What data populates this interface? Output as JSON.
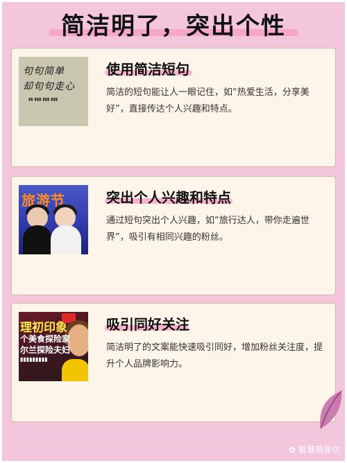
{
  "header": {
    "title": "简洁明了，突出个性"
  },
  "cards": [
    {
      "title": "使用简洁短句",
      "description": "简洁的短句能让人一眼记住，如“热爱生活，分享美好”，直接传达个人兴趣和特点。",
      "thumb": {
        "line1": "句句简单",
        "line2": "却句句走心"
      }
    },
    {
      "title": "突出个人兴趣和特点",
      "description": "通过短句突出个人兴趣，如“旅行达人，带你走遍世界”，吸引有相同兴趣的粉丝。",
      "thumb": {
        "tag": "旅游节"
      }
    },
    {
      "title": "吸引同好关注",
      "description": "简洁明了的文案能快速吸引同好，增加粉丝关注度，提升个人品牌影响力。",
      "thumb": {
        "line1": "理初印象",
        "line2": "个美食探险家",
        "line3": "尔兰探险夫妇"
      }
    }
  ],
  "watermark": "智慧萌芽坊",
  "colors": {
    "background": "#f3c6dc",
    "card": "#fdf4ea",
    "highlight": "#f6a6c9"
  }
}
